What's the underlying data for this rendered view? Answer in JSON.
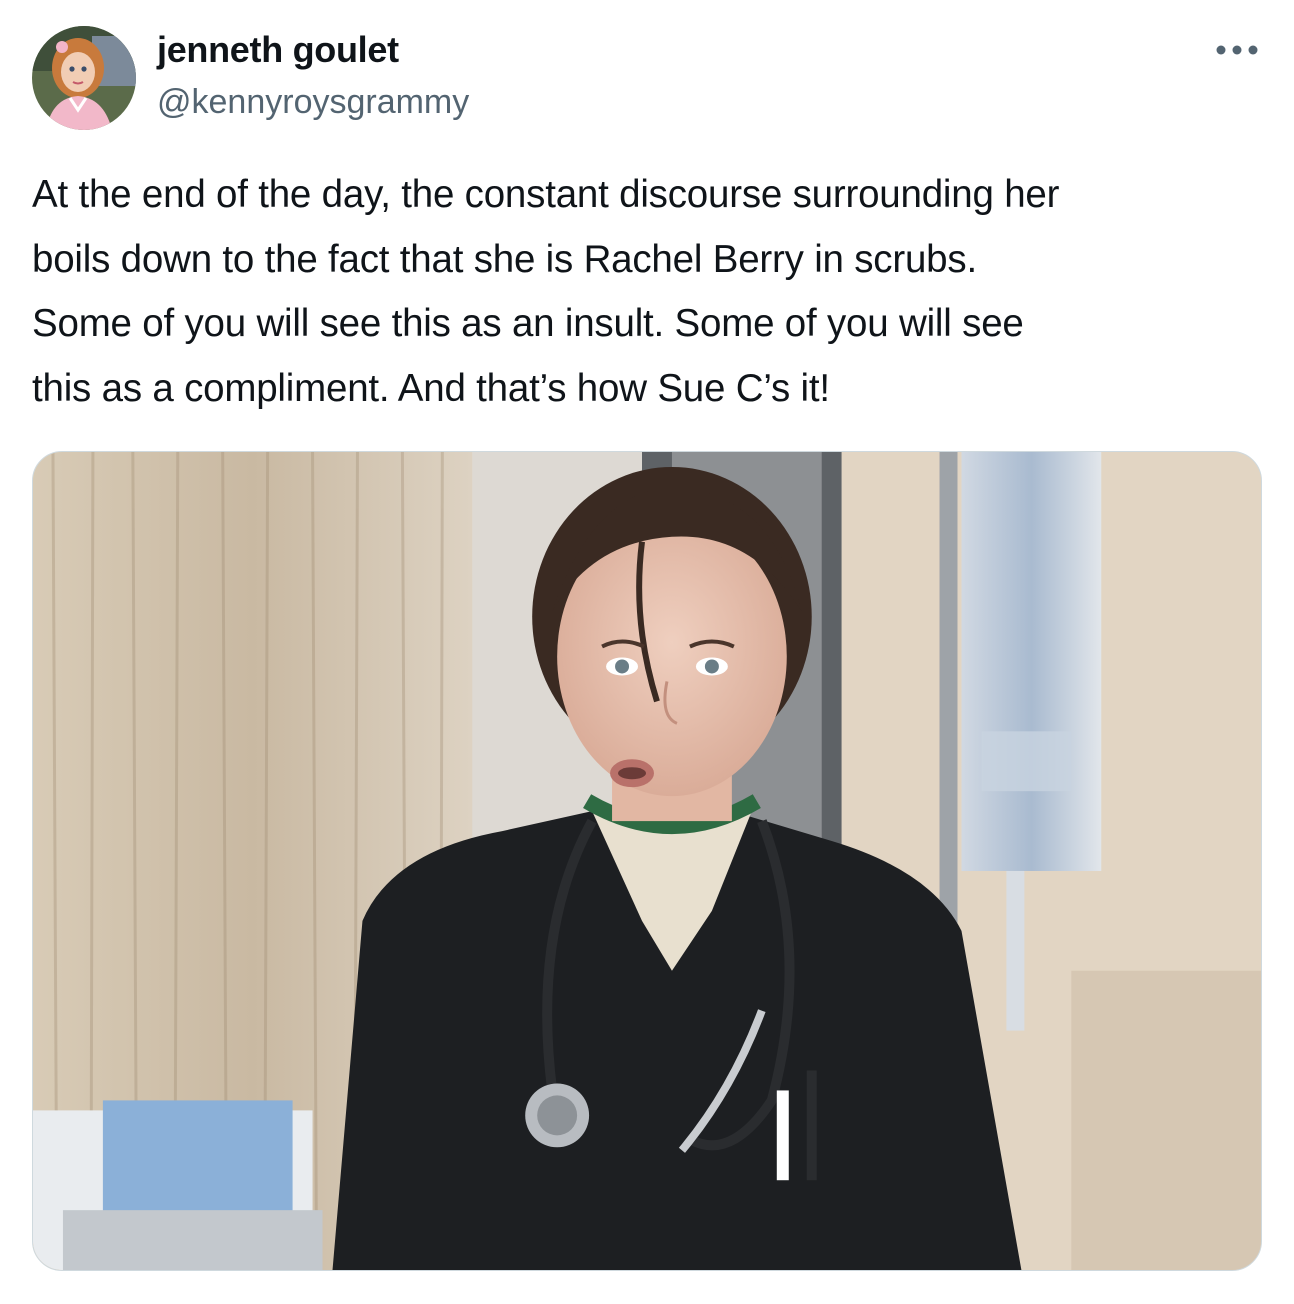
{
  "author": {
    "display_name": "jenneth goulet",
    "handle": "@kennyroysgrammy",
    "avatar_icon": "doll-avatar"
  },
  "actions": {
    "more_icon": "more-horizontal-icon"
  },
  "tweet": {
    "text_lines": [
      "At the end of the day, the constant discourse surrounding her",
      "boils down to the fact that she is Rachel Berry in scrubs.",
      "Some of you will see this as an insult. Some of you will see",
      "this as a compliment. And that’s how Sue C’s it!"
    ]
  },
  "colors": {
    "text": "#0f1419",
    "secondary_text": "#536471",
    "media_border": "#cfd9de"
  }
}
